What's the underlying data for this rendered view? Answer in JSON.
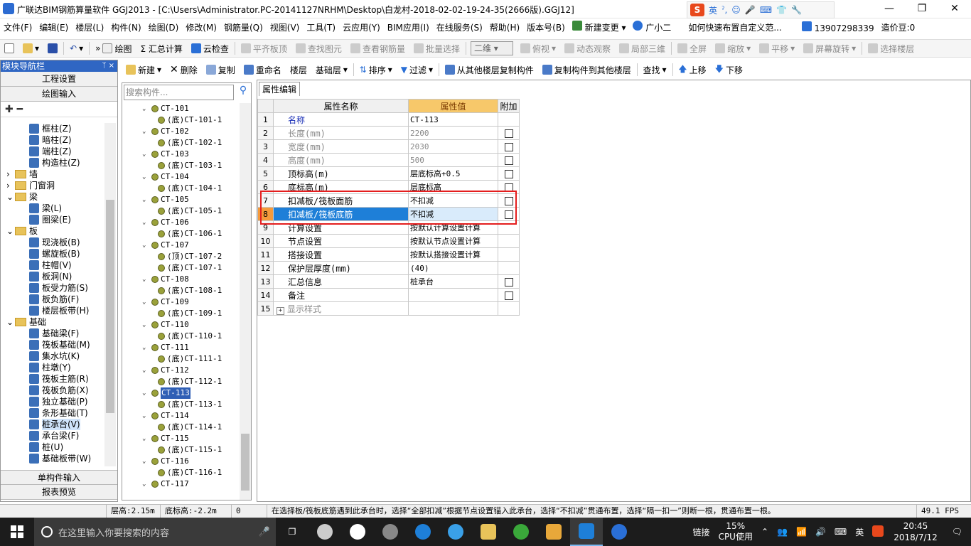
{
  "titlebar": {
    "title": "广联达BIM钢筋算量软件 GGJ2013 - [C:\\Users\\Administrator.PC-20141127NRHM\\Desktop\\白龙村-2018-02-02-19-24-35(2666版).GGJ12]",
    "ime_lang": "英",
    "minimize": "—",
    "restore": "❐",
    "close": "✕"
  },
  "menubar": {
    "items": [
      "文件(F)",
      "编辑(E)",
      "楼层(L)",
      "构件(N)",
      "绘图(D)",
      "修改(M)",
      "钢筋量(Q)",
      "视图(V)",
      "工具(T)",
      "云应用(Y)",
      "BIM应用(I)",
      "在线服务(S)",
      "帮助(H)",
      "版本号(B)"
    ],
    "new_change": "新建变更",
    "assistant": "广小二",
    "tip": "如何快速布置自定义范...",
    "phone": "13907298339",
    "cost_bean": "造价豆:0"
  },
  "toolbar1": {
    "draw": "绘图",
    "sum": "Σ 汇总计算",
    "cloud_check": "云检查",
    "align_top": "平齐板顶",
    "find_element": "查找图元",
    "view_rebar": "查看钢筋量",
    "batch_select": "批量选择",
    "view_mode": "二维",
    "top_view": "俯视",
    "dyn_view": "动态观察",
    "local_3d": "局部三维",
    "fullscreen": "全屏",
    "zoom": "缩放",
    "pan": "平移",
    "rotate": "屏幕旋转",
    "select_floor": "选择楼层"
  },
  "cl_toolbar": {
    "new": "新建",
    "delete": "删除",
    "copy": "复制",
    "rename": "重命名",
    "floor_label": "楼层",
    "floor_value": "基础层",
    "sort": "排序",
    "filter": "过滤",
    "copy_from": "从其他楼层复制构件",
    "copy_to": "复制构件到其他楼层",
    "find": "查找",
    "up": "上移",
    "down": "下移"
  },
  "nav": {
    "header": "模块导航栏",
    "pin": "ᛉ ×",
    "eng_settings": "工程设置",
    "draw_input": "绘图输入",
    "tree_tools": "✚ ━",
    "items": [
      {
        "label": "框柱(Z)",
        "type": "item"
      },
      {
        "label": "暗柱(Z)",
        "type": "item"
      },
      {
        "label": "端柱(Z)",
        "type": "item"
      },
      {
        "label": "构造柱(Z)",
        "type": "item"
      },
      {
        "label": "墙",
        "type": "folder",
        "expander": "›"
      },
      {
        "label": "门窗洞",
        "type": "folder",
        "expander": "›"
      },
      {
        "label": "梁",
        "type": "folder",
        "expander": "⌄"
      },
      {
        "label": "梁(L)",
        "type": "item"
      },
      {
        "label": "圈梁(E)",
        "type": "item"
      },
      {
        "label": "板",
        "type": "folder",
        "expander": "⌄"
      },
      {
        "label": "现浇板(B)",
        "type": "item"
      },
      {
        "label": "螺旋板(B)",
        "type": "item"
      },
      {
        "label": "柱帽(V)",
        "type": "item"
      },
      {
        "label": "板洞(N)",
        "type": "item"
      },
      {
        "label": "板受力筋(S)",
        "type": "item"
      },
      {
        "label": "板负筋(F)",
        "type": "item"
      },
      {
        "label": "楼层板带(H)",
        "type": "item"
      },
      {
        "label": "基础",
        "type": "folder",
        "expander": "⌄"
      },
      {
        "label": "基础梁(F)",
        "type": "item"
      },
      {
        "label": "筏板基础(M)",
        "type": "item"
      },
      {
        "label": "集水坑(K)",
        "type": "item"
      },
      {
        "label": "柱墩(Y)",
        "type": "item"
      },
      {
        "label": "筏板主筋(R)",
        "type": "item"
      },
      {
        "label": "筏板负筋(X)",
        "type": "item"
      },
      {
        "label": "独立基础(P)",
        "type": "item"
      },
      {
        "label": "条形基础(T)",
        "type": "item"
      },
      {
        "label": "桩承台(V)",
        "type": "item",
        "selected": true
      },
      {
        "label": "承台梁(F)",
        "type": "item"
      },
      {
        "label": "桩(U)",
        "type": "item"
      },
      {
        "label": "基础板带(W)",
        "type": "item"
      }
    ],
    "single_input": "单构件输入",
    "report_preview": "报表预览"
  },
  "component_list": {
    "search_placeholder": "搜索构件...",
    "search_icon": "⚲",
    "items": [
      {
        "label": "CT-101",
        "level": 0
      },
      {
        "label": "(底)CT-101-1",
        "level": 1
      },
      {
        "label": "CT-102",
        "level": 0
      },
      {
        "label": "(底)CT-102-1",
        "level": 1
      },
      {
        "label": "CT-103",
        "level": 0
      },
      {
        "label": "(底)CT-103-1",
        "level": 1
      },
      {
        "label": "CT-104",
        "level": 0
      },
      {
        "label": "(底)CT-104-1",
        "level": 1
      },
      {
        "label": "CT-105",
        "level": 0
      },
      {
        "label": "(底)CT-105-1",
        "level": 1
      },
      {
        "label": "CT-106",
        "level": 0
      },
      {
        "label": "(底)CT-106-1",
        "level": 1
      },
      {
        "label": "CT-107",
        "level": 0
      },
      {
        "label": "(顶)CT-107-2",
        "level": 1
      },
      {
        "label": "(底)CT-107-1",
        "level": 1
      },
      {
        "label": "CT-108",
        "level": 0
      },
      {
        "label": "(底)CT-108-1",
        "level": 1
      },
      {
        "label": "CT-109",
        "level": 0
      },
      {
        "label": "(底)CT-109-1",
        "level": 1
      },
      {
        "label": "CT-110",
        "level": 0
      },
      {
        "label": "(底)CT-110-1",
        "level": 1
      },
      {
        "label": "CT-111",
        "level": 0
      },
      {
        "label": "(底)CT-111-1",
        "level": 1
      },
      {
        "label": "CT-112",
        "level": 0
      },
      {
        "label": "(底)CT-112-1",
        "level": 1
      },
      {
        "label": "CT-113",
        "level": 0,
        "selected": true
      },
      {
        "label": "(底)CT-113-1",
        "level": 1
      },
      {
        "label": "CT-114",
        "level": 0
      },
      {
        "label": "(底)CT-114-1",
        "level": 1
      },
      {
        "label": "CT-115",
        "level": 0
      },
      {
        "label": "(底)CT-115-1",
        "level": 1
      },
      {
        "label": "CT-116",
        "level": 0
      },
      {
        "label": "(底)CT-116-1",
        "level": 1
      },
      {
        "label": "CT-117",
        "level": 0
      }
    ]
  },
  "properties": {
    "tab": "属性编辑",
    "col_name": "属性名称",
    "col_value": "属性值",
    "col_extra": "附加",
    "rows": [
      {
        "num": "1",
        "name": "名称",
        "value": "CT-113",
        "style": "blue",
        "check": false
      },
      {
        "num": "2",
        "name": "长度(mm)",
        "value": "2200",
        "style": "gray",
        "check": true
      },
      {
        "num": "3",
        "name": "宽度(mm)",
        "value": "2030",
        "style": "gray",
        "check": true
      },
      {
        "num": "4",
        "name": "高度(mm)",
        "value": "500",
        "style": "gray",
        "check": true
      },
      {
        "num": "5",
        "name": "顶标高(m)",
        "value": "层底标高+0.5",
        "style": "",
        "check": true
      },
      {
        "num": "6",
        "name": "底标高(m)",
        "value": "层底标高",
        "style": "",
        "check": true
      },
      {
        "num": "7",
        "name": "扣减板/筏板面筋",
        "value": "不扣减",
        "style": "",
        "check": true
      },
      {
        "num": "8",
        "name": "扣减板/筏板底筋",
        "value": "不扣减",
        "style": "sel",
        "check": true
      },
      {
        "num": "9",
        "name": "计算设置",
        "value": "按默认计算设置计算",
        "style": "",
        "check": false
      },
      {
        "num": "10",
        "name": "节点设置",
        "value": "按默认节点设置计算",
        "style": "",
        "check": false
      },
      {
        "num": "11",
        "name": "搭接设置",
        "value": "按默认搭接设置计算",
        "style": "",
        "check": false
      },
      {
        "num": "12",
        "name": "保护层厚度(mm)",
        "value": "(40)",
        "style": "",
        "check": false
      },
      {
        "num": "13",
        "name": "汇总信息",
        "value": "桩承台",
        "style": "",
        "check": true
      },
      {
        "num": "14",
        "name": "备注",
        "value": "",
        "style": "",
        "check": true
      },
      {
        "num": "15",
        "name": "显示样式",
        "value": "",
        "style": "gray",
        "check": false,
        "expander": "+"
      }
    ]
  },
  "statusbar": {
    "floor_height": "层高:2.15m",
    "bottom_elev": "底标高:-2.2m",
    "zero": "0",
    "hint": "在选择板/筏板底筋遇到此承台时，选择“全部扣减”根据节点设置锚入此承台，选择“不扣减”贯通布置，选择“隔一扣一”则断一根，贯通布置一根。",
    "fps": "49.1 FPS"
  },
  "taskbar": {
    "search_placeholder": "在这里输入你要搜索的内容",
    "link": "链接",
    "cpu_percent": "15%",
    "cpu_label": "CPU使用",
    "ime": "英",
    "time": "20:45",
    "date": "2018/7/12"
  }
}
